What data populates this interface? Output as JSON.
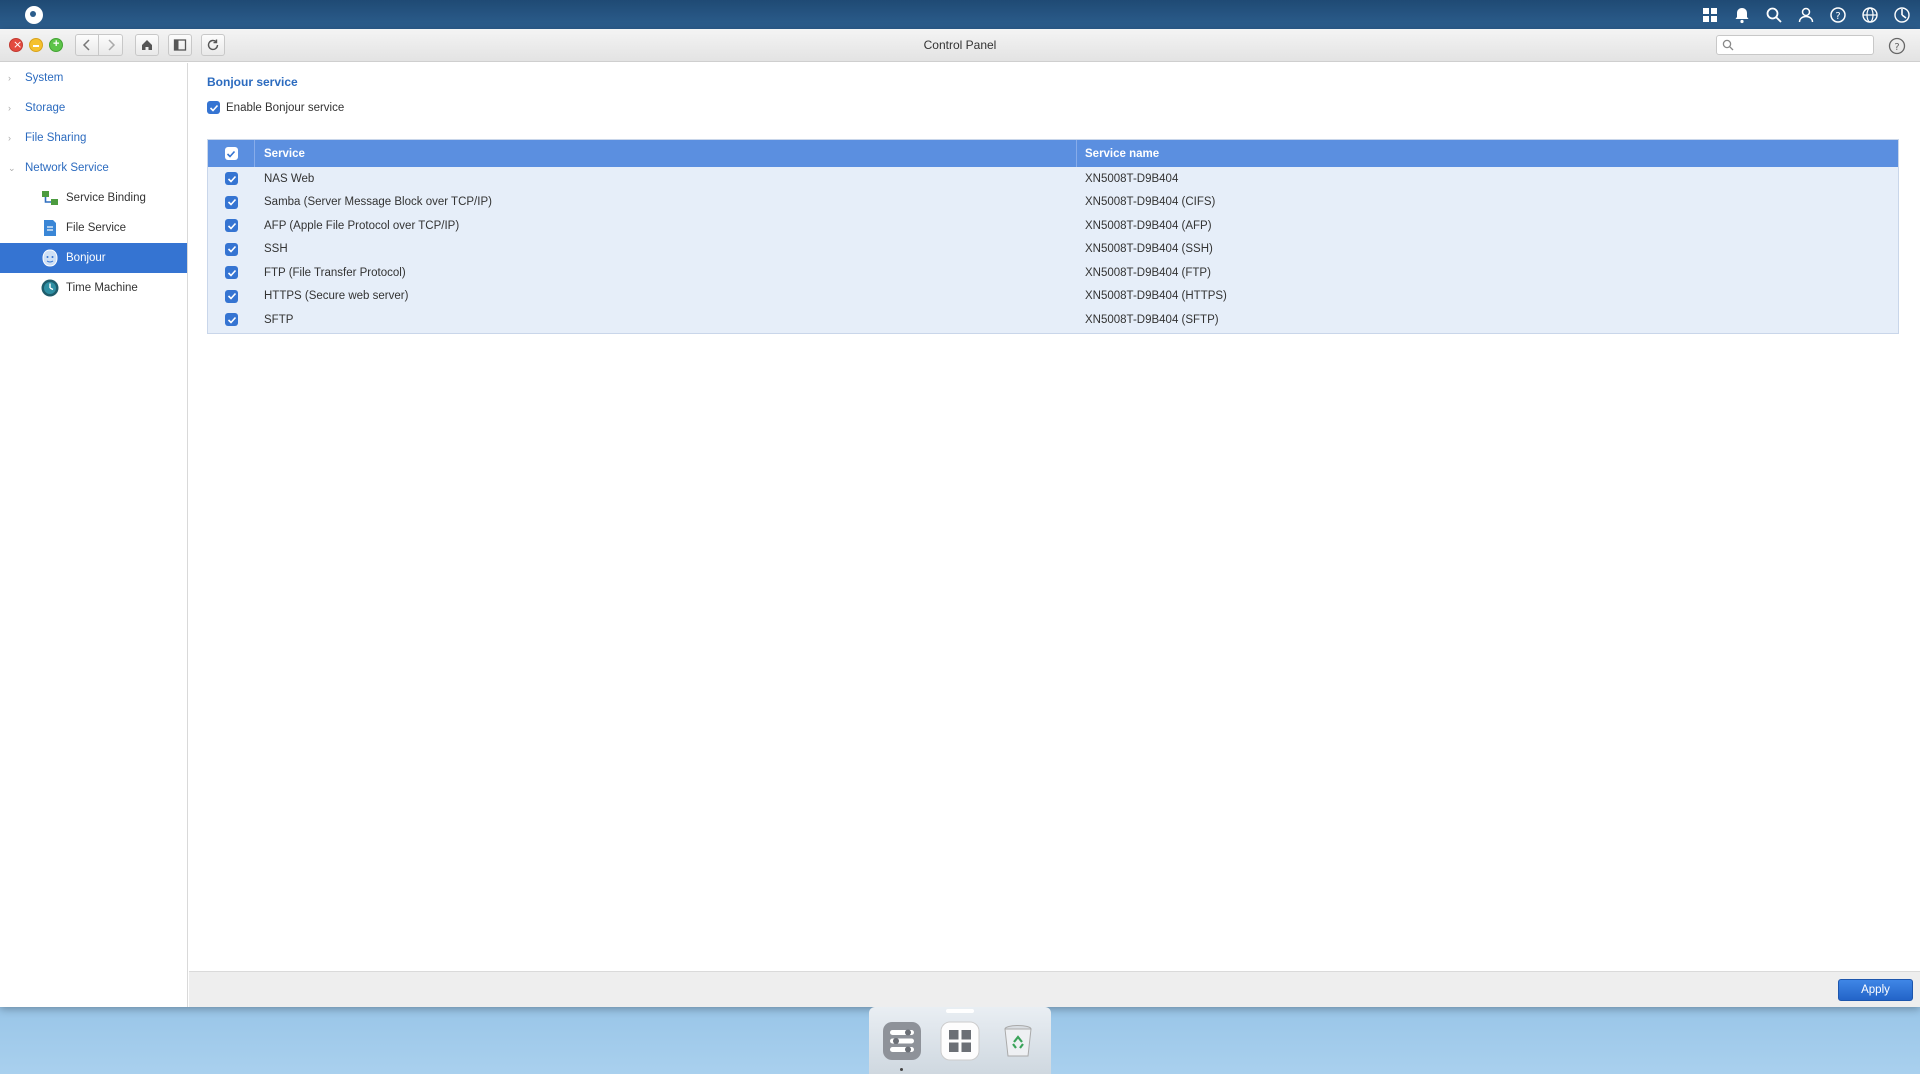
{
  "window": {
    "title": "Control Panel",
    "search_placeholder": ""
  },
  "sidebar": {
    "categories": [
      {
        "label": "System"
      },
      {
        "label": "Storage"
      },
      {
        "label": "File Sharing"
      },
      {
        "label": "Network Service"
      }
    ],
    "items": [
      {
        "label": "Service Binding",
        "icon": "service-binding-icon"
      },
      {
        "label": "File Service",
        "icon": "file-service-icon"
      },
      {
        "label": "Bonjour",
        "icon": "bonjour-icon"
      },
      {
        "label": "Time Machine",
        "icon": "time-machine-icon"
      }
    ]
  },
  "main": {
    "section_title": "Bonjour service",
    "enable_label": "Enable Bonjour service",
    "table": {
      "headers": {
        "service": "Service",
        "name": "Service name"
      },
      "rows": [
        {
          "service": "NAS Web",
          "name": "XN5008T-D9B404"
        },
        {
          "service": "Samba (Server Message Block over TCP/IP)",
          "name": "XN5008T-D9B404 (CIFS)"
        },
        {
          "service": "AFP (Apple File Protocol over TCP/IP)",
          "name": "XN5008T-D9B404 (AFP)"
        },
        {
          "service": "SSH",
          "name": "XN5008T-D9B404 (SSH)"
        },
        {
          "service": "FTP (File Transfer Protocol)",
          "name": "XN5008T-D9B404 (FTP)"
        },
        {
          "service": "HTTPS (Secure web server)",
          "name": "XN5008T-D9B404 (HTTPS)"
        },
        {
          "service": "SFTP",
          "name": "XN5008T-D9B404 (SFTP)"
        }
      ]
    }
  },
  "footer": {
    "apply_label": "Apply"
  },
  "colors": {
    "accent": "#3574d2",
    "header": "#5b8fe0",
    "row_bg": "#e6eef9"
  }
}
